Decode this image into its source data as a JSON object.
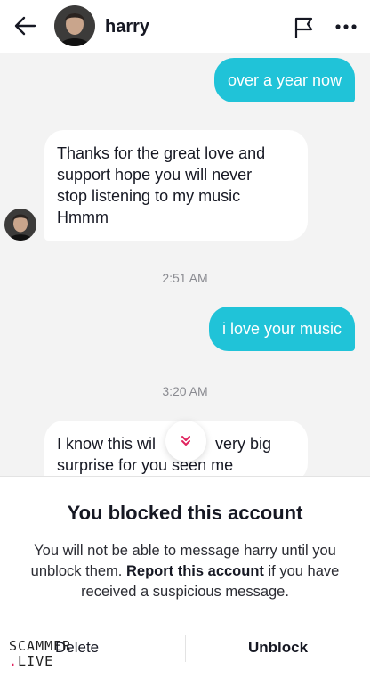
{
  "header": {
    "username": "harry",
    "back_icon": "arrow-left-icon",
    "flag_icon": "flag-icon",
    "more_icon": "more-horizontal-icon"
  },
  "messages": [
    {
      "direction": "out",
      "text": "over a year now"
    },
    {
      "direction": "in",
      "lines": [
        "Thanks for the great love and",
        "support hope you will never",
        "stop listening to my music",
        "Hmmm"
      ]
    },
    {
      "timestamp": "2:51 AM"
    },
    {
      "direction": "out",
      "text": "i love your music"
    },
    {
      "timestamp": "3:20 AM"
    },
    {
      "direction": "in",
      "lines": [
        "I know this wil",
        "very big",
        "surprise for you seen me"
      ]
    }
  ],
  "scroll_icon": "double-chevron-down-icon",
  "blocked_panel": {
    "title": "You blocked this account",
    "desc_part1": "You will not be able to message harry until you unblock them.",
    "desc_bold": "Report this account",
    "desc_part2": "if you have received a suspicious message.",
    "delete_label": "Delete",
    "unblock_label": "Unblock"
  },
  "watermark": {
    "line1": "SCAMMER",
    "line2": "LIVE"
  },
  "colors": {
    "accent_bubble": "#20c3d8",
    "background": "#f3f3f3"
  }
}
